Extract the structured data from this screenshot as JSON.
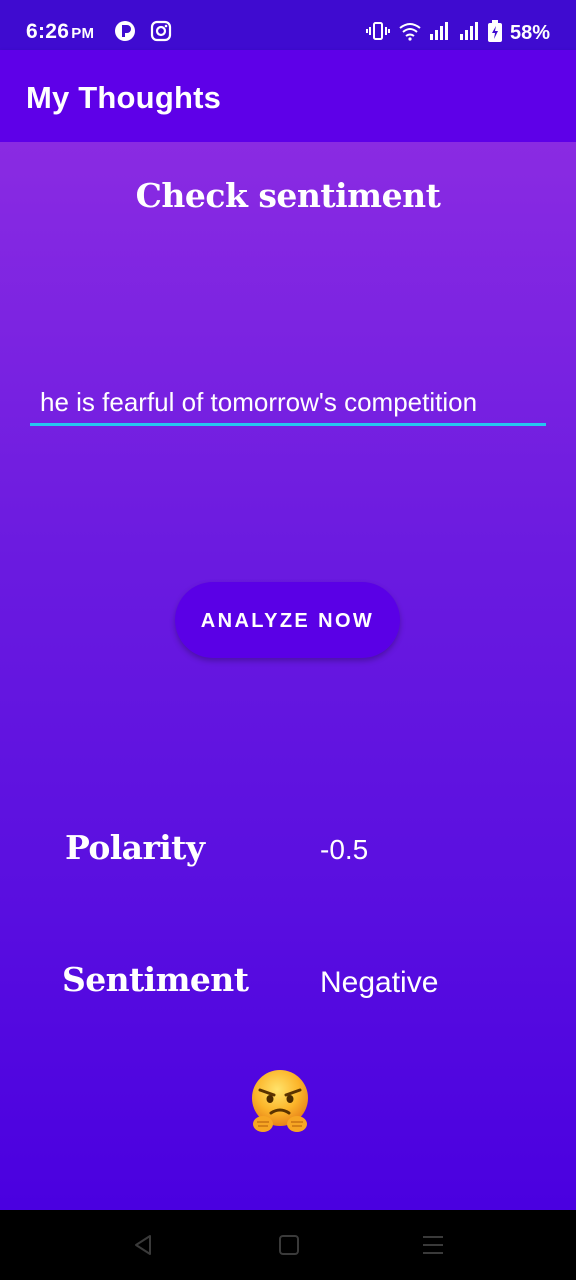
{
  "status_bar": {
    "time": "6:26",
    "ampm": "PM",
    "battery": "58%",
    "icons": [
      "pinterest-like-icon",
      "instagram-icon",
      "vibrate-icon",
      "wifi-icon",
      "signal-icon",
      "signal-icon-2",
      "battery-icon"
    ]
  },
  "app_bar": {
    "title": "My Thoughts"
  },
  "main": {
    "heading": "Check sentiment",
    "input_value": "he is fearful of tomorrow's competition",
    "analyze_button": "ANALYZE NOW",
    "polarity_label": "Polarity",
    "polarity_value": "-0.5",
    "sentiment_label": "Sentiment",
    "sentiment_value": "Negative",
    "emoji": "angry-face-emoji"
  },
  "nav_bar": {
    "buttons": [
      "back-icon",
      "home-icon",
      "menu-icon"
    ]
  },
  "colors": {
    "status_bar": "#3f0bd0",
    "app_bar": "#5e00e8",
    "gradient_top": "#8a2be2",
    "gradient_bottom": "#4a00e0",
    "button": "#5a00e6",
    "input_underline": "#26c6f0"
  }
}
